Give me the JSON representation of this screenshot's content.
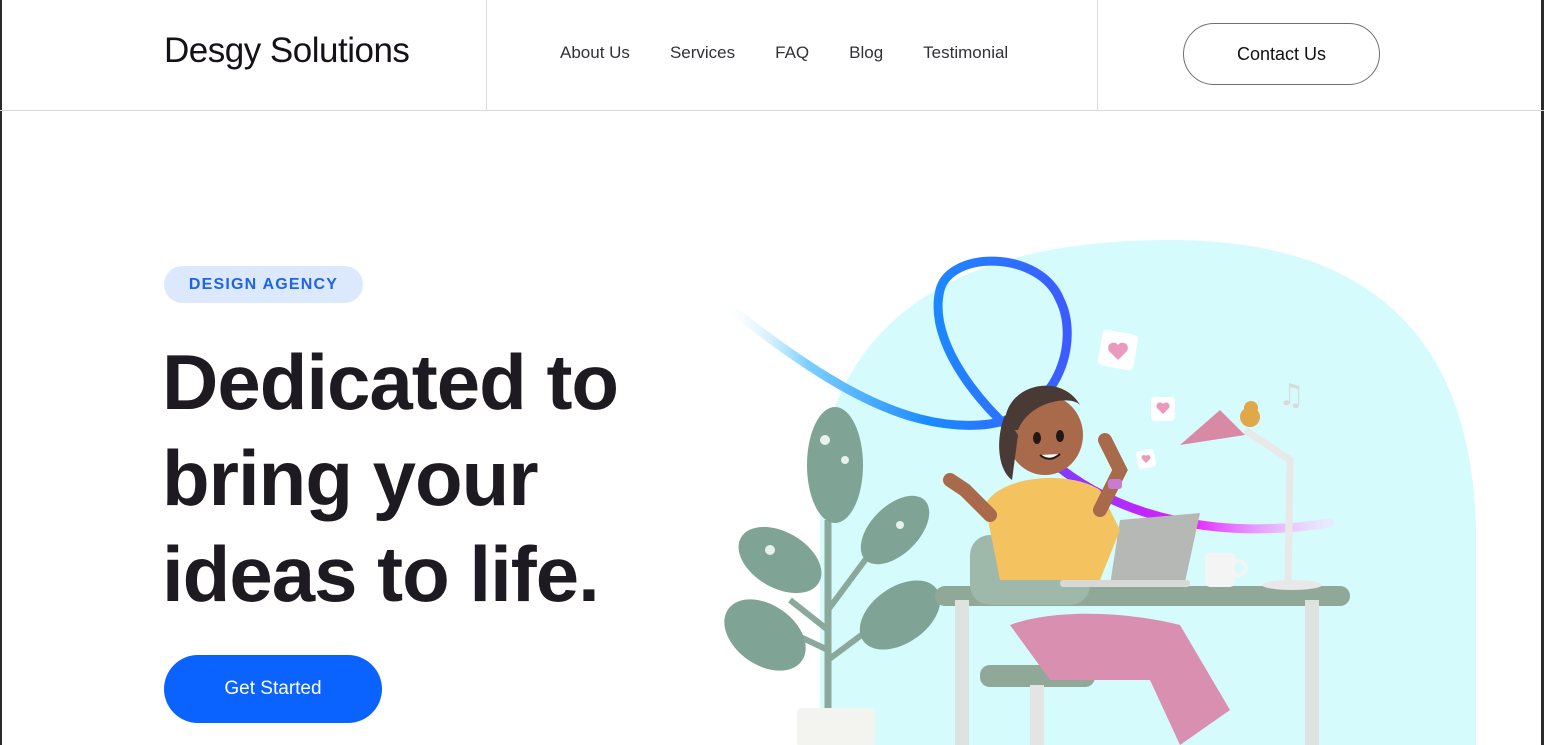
{
  "header": {
    "logo": "Desgy Solutions",
    "nav": [
      "About Us",
      "Services",
      "FAQ",
      "Blog",
      "Testimonial"
    ],
    "contact_label": "Contact Us"
  },
  "hero": {
    "badge": "DESIGN AGENCY",
    "headline_lines": [
      "Dedicated to",
      "bring your",
      "ideas to life."
    ],
    "cta_label": "Get Started"
  },
  "colors": {
    "primary": "#0a62ff",
    "badge_bg": "#dce8fb",
    "badge_text": "#1e64e6",
    "illustration_bg": "#d6fbfd"
  }
}
